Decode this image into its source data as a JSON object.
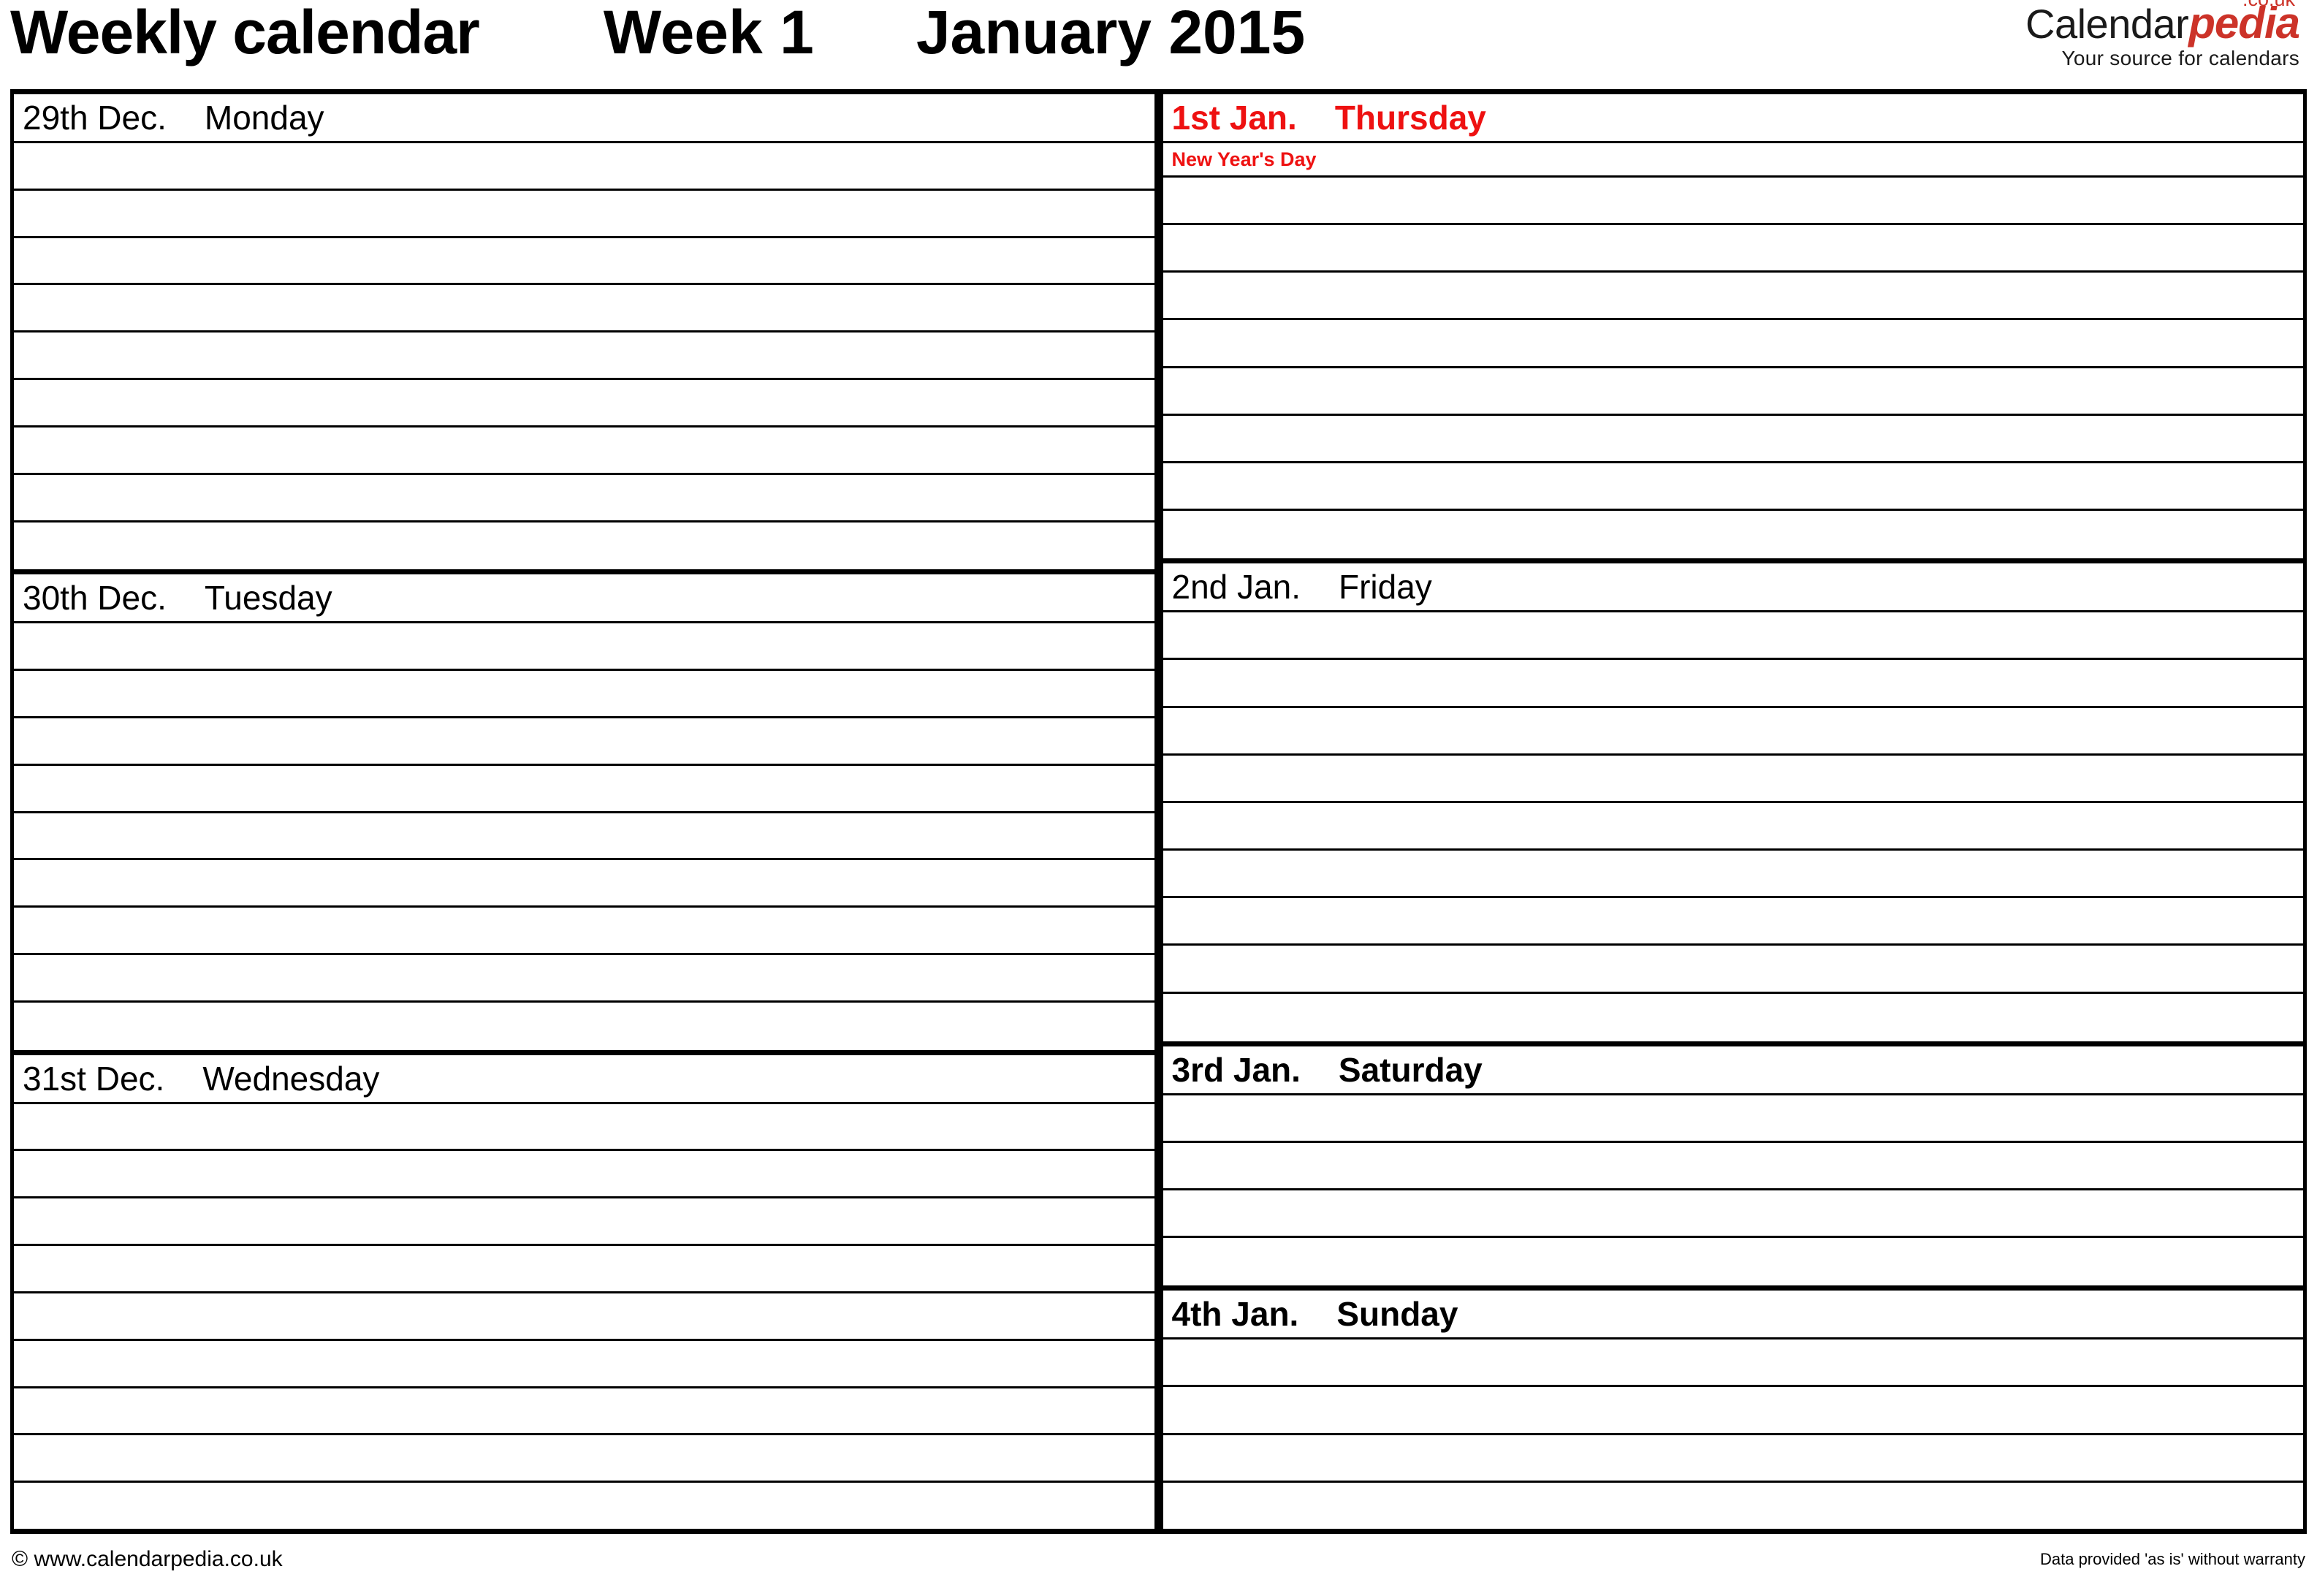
{
  "header": {
    "title": "Weekly calendar",
    "week": "Week 1",
    "month_year": "January 2015"
  },
  "logo": {
    "brand_main": "Calendar",
    "brand_accent": "pedia",
    "tld": ".co.uk",
    "tagline": "Your source for calendars",
    "accent_color": "#cc3329"
  },
  "colors": {
    "holiday_red": "#ee1111",
    "rule_black": "#000000"
  },
  "calendar": {
    "left_column": [
      {
        "date": "29th Dec.",
        "dayname": "Monday",
        "style": "normal",
        "holiday": null,
        "blank_rows": 9
      },
      {
        "date": "30th Dec.",
        "dayname": "Tuesday",
        "style": "normal",
        "holiday": null,
        "blank_rows": 9
      },
      {
        "date": "31st Dec.",
        "dayname": "Wednesday",
        "style": "normal",
        "holiday": null,
        "blank_rows": 9
      }
    ],
    "right_column": [
      {
        "date": "1st Jan.",
        "dayname": "Thursday",
        "style": "red",
        "holiday": "New Year's Day",
        "blank_rows": 8
      },
      {
        "date": "2nd Jan.",
        "dayname": "Friday",
        "style": "normal",
        "holiday": null,
        "blank_rows": 9
      },
      {
        "date": "3rd Jan.",
        "dayname": "Saturday",
        "style": "bold",
        "holiday": null,
        "blank_rows": 4
      },
      {
        "date": "4th Jan.",
        "dayname": "Sunday",
        "style": "bold",
        "holiday": null,
        "blank_rows": 4
      }
    ]
  },
  "footer": {
    "left": "© www.calendarpedia.co.uk",
    "right": "Data provided 'as is' without warranty"
  }
}
